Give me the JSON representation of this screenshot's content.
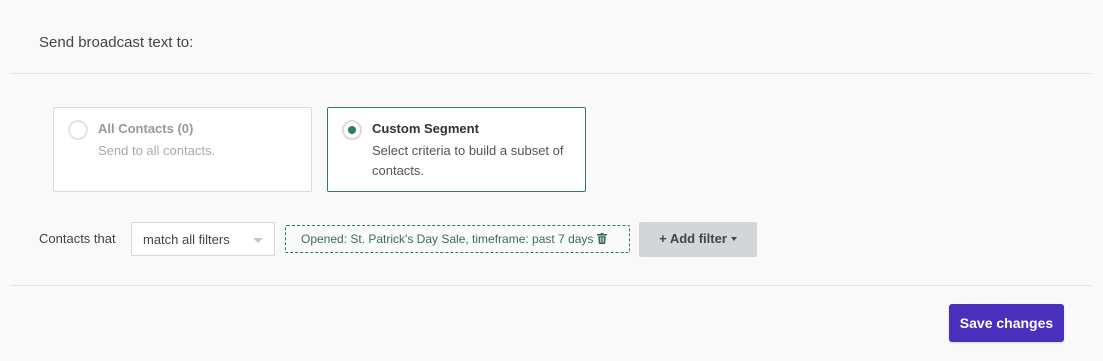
{
  "header": {
    "title": "Send broadcast text to:"
  },
  "options": [
    {
      "title": "All Contacts (0)",
      "description": "Send to all contacts.",
      "selected": false
    },
    {
      "title": "Custom Segment",
      "description": "Select criteria to build a subset of contacts.",
      "selected": true
    }
  ],
  "filters": {
    "label": "Contacts that",
    "match_value": "match all filters",
    "chips": [
      {
        "text": "Opened: St. Patrick's Day Sale, timeframe: past 7 days"
      }
    ],
    "add_filter_label": "+ Add filter"
  },
  "footer": {
    "save_label": "Save changes"
  },
  "colors": {
    "accent": "#2f7a5f",
    "primary_button": "#4a2fbd",
    "secondary_button": "#d3d6d8"
  },
  "icons": {
    "filter_remove": "trash-icon",
    "select_caret": "caret-down-icon",
    "add_filter_caret": "caret-down-icon"
  }
}
